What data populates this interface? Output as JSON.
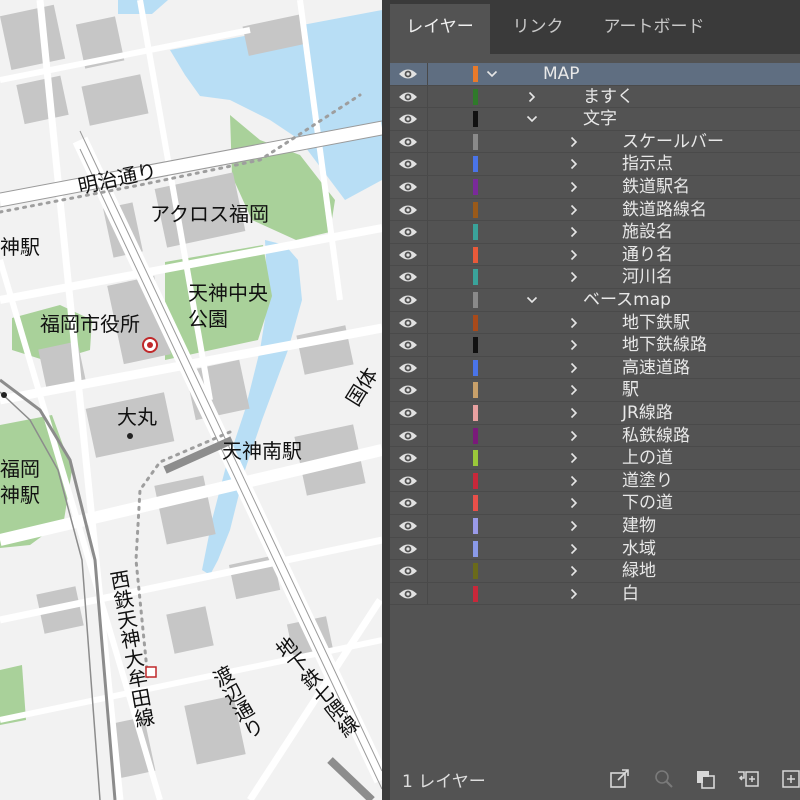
{
  "colors": {
    "map_bg": "#f2f2f2",
    "building": "#c6c6c6",
    "water": "#b8def5",
    "green": "#a9d19a",
    "road": "#ffffff",
    "panel_bg": "#535353",
    "selected_row": "#5f6e81"
  },
  "map": {
    "labels": {
      "meiji_dori": "明治通り",
      "across_fukuoka": "アクロス福岡",
      "tenjin_station": "神駅",
      "tenjin_chuo_park_line1": "天神中央",
      "tenjin_chuo_park_line2": "公園",
      "city_hall": "福岡市役所",
      "daimaru": "大丸",
      "tenjin_minami_station": "天神南駅",
      "kokutai": "国体",
      "fukuoka_tenjin_line1": "福岡",
      "fukuoka_tenjin_line2": "神駅",
      "nishitetsu_station": "西鉄天神大牟田線",
      "watanabe_dori": "渡辺通り",
      "nanakuma_line": "地下鉄七隈線"
    },
    "icons": [
      "city-hall-marker-icon",
      "station-square-icon",
      "poi-dot-icon"
    ]
  },
  "panel": {
    "tabs": [
      {
        "label": "レイヤー",
        "active": true
      },
      {
        "label": "リンク",
        "active": false
      },
      {
        "label": "アートボード",
        "active": false
      }
    ],
    "layers": [
      {
        "name": "MAP",
        "color": "#e87a2a",
        "indent": 0,
        "expanded": true,
        "selected": true
      },
      {
        "name": "ますく",
        "color": "#2f7a2a",
        "indent": 1,
        "expanded": false,
        "selected": false
      },
      {
        "name": "文字",
        "color": "#111111",
        "indent": 1,
        "expanded": true,
        "selected": false
      },
      {
        "name": "スケールバー",
        "color": "#8a8a8a",
        "indent": 2,
        "expanded": false,
        "selected": false
      },
      {
        "name": "指示点",
        "color": "#4a74e8",
        "indent": 2,
        "expanded": false,
        "selected": false
      },
      {
        "name": "鉄道駅名",
        "color": "#7a2a9a",
        "indent": 2,
        "expanded": false,
        "selected": false
      },
      {
        "name": "鉄道路線名",
        "color": "#9a5a1a",
        "indent": 2,
        "expanded": false,
        "selected": false
      },
      {
        "name": "施設名",
        "color": "#3aa39a",
        "indent": 2,
        "expanded": false,
        "selected": false
      },
      {
        "name": "通り名",
        "color": "#e85a3a",
        "indent": 2,
        "expanded": false,
        "selected": false
      },
      {
        "name": "河川名",
        "color": "#3aa39a",
        "indent": 2,
        "expanded": false,
        "selected": false
      },
      {
        "name": "ベースmap",
        "color": "#8a8a8a",
        "indent": 1,
        "expanded": true,
        "selected": false
      },
      {
        "name": "地下鉄駅",
        "color": "#a84a1a",
        "indent": 2,
        "expanded": false,
        "selected": false
      },
      {
        "name": "地下鉄線路",
        "color": "#111111",
        "indent": 2,
        "expanded": false,
        "selected": false
      },
      {
        "name": "高速道路",
        "color": "#4a74e8",
        "indent": 2,
        "expanded": false,
        "selected": false
      },
      {
        "name": "駅",
        "color": "#c8a06a",
        "indent": 2,
        "expanded": false,
        "selected": false
      },
      {
        "name": "JR線路",
        "color": "#e8a0a0",
        "indent": 2,
        "expanded": false,
        "selected": false
      },
      {
        "name": "私鉄線路",
        "color": "#7a1a7a",
        "indent": 2,
        "expanded": false,
        "selected": false
      },
      {
        "name": "上の道",
        "color": "#9ac83a",
        "indent": 2,
        "expanded": false,
        "selected": false
      },
      {
        "name": "道塗り",
        "color": "#c8283a",
        "indent": 2,
        "expanded": false,
        "selected": false
      },
      {
        "name": "下の道",
        "color": "#e8504a",
        "indent": 2,
        "expanded": false,
        "selected": false
      },
      {
        "name": "建物",
        "color": "#9a9ae8",
        "indent": 2,
        "expanded": false,
        "selected": false
      },
      {
        "name": "水域",
        "color": "#8a9ae8",
        "indent": 2,
        "expanded": false,
        "selected": false
      },
      {
        "name": "緑地",
        "color": "#6a6a1a",
        "indent": 2,
        "expanded": false,
        "selected": false
      },
      {
        "name": "白",
        "color": "#c8283a",
        "indent": 2,
        "expanded": false,
        "selected": false
      }
    ],
    "footer": {
      "layer_count": "1 レイヤー",
      "buttons": [
        "export-icon",
        "search-icon",
        "locate-object-icon",
        "new-sublayer-icon",
        "new-layer-icon"
      ]
    }
  }
}
